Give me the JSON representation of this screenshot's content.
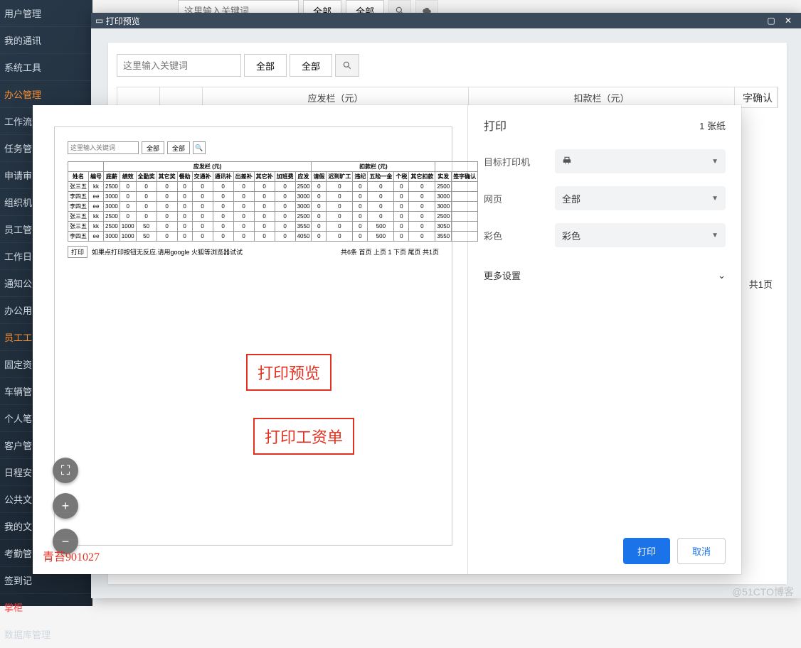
{
  "sidebar": {
    "items": [
      {
        "label": "用户管理"
      },
      {
        "label": "我的通讯"
      },
      {
        "label": "系统工具"
      },
      {
        "label": "办公管理",
        "active": true
      },
      {
        "label": "工作流"
      },
      {
        "label": "任务管"
      },
      {
        "label": "申请审"
      },
      {
        "label": "组织机"
      },
      {
        "label": "员工管"
      },
      {
        "label": "工作日"
      },
      {
        "label": "通知公"
      },
      {
        "label": "办公用"
      },
      {
        "label": "员工工",
        "active": true
      },
      {
        "label": "固定资"
      },
      {
        "label": "车辆管"
      },
      {
        "label": "个人笔"
      },
      {
        "label": "客户管"
      },
      {
        "label": "日程安"
      },
      {
        "label": "公共文"
      },
      {
        "label": "我的文"
      },
      {
        "label": "考勤管"
      },
      {
        "label": "签到记"
      },
      {
        "label": "掌柜",
        "danger": true
      },
      {
        "label": "数据库管理"
      }
    ]
  },
  "bg_toolbar": {
    "placeholder": "这里输入关键词",
    "sel1": "全部",
    "sel2": "全部"
  },
  "modal": {
    "title": "打印预览",
    "inner_placeholder": "这里输入关键词",
    "inner_sel1": "全部",
    "inner_sel2": "全部",
    "bg_table_h1": "应发栏（元）",
    "bg_table_h2": "扣款栏（元）",
    "bg_right_label": "字确认",
    "bg_pagecount": "共1页"
  },
  "preview": {
    "placeholder": "这里输入关键词",
    "sel1": "全部",
    "sel2": "全部",
    "group_pay": "应发栏 (元)",
    "group_deduct": "扣款栏 (元)",
    "cols": [
      "姓名",
      "编号",
      "底薪",
      "绩效",
      "全勤奖",
      "其它奖",
      "餐助",
      "交通补",
      "通讯补",
      "出差补",
      "其它补",
      "加班费",
      "应发",
      "请假",
      "迟到旷工",
      "违纪",
      "五险一金",
      "个税",
      "其它扣款",
      "实发",
      "签字确认"
    ],
    "rows": [
      [
        "张三五",
        "kk",
        "2500",
        "0",
        "0",
        "0",
        "0",
        "0",
        "0",
        "0",
        "0",
        "0",
        "2500",
        "0",
        "0",
        "0",
        "0",
        "0",
        "0",
        "2500",
        ""
      ],
      [
        "李四五",
        "ee",
        "3000",
        "0",
        "0",
        "0",
        "0",
        "0",
        "0",
        "0",
        "0",
        "0",
        "3000",
        "0",
        "0",
        "0",
        "0",
        "0",
        "0",
        "3000",
        ""
      ],
      [
        "李四五",
        "ee",
        "3000",
        "0",
        "0",
        "0",
        "0",
        "0",
        "0",
        "0",
        "0",
        "0",
        "3000",
        "0",
        "0",
        "0",
        "0",
        "0",
        "0",
        "3000",
        ""
      ],
      [
        "张三五",
        "kk",
        "2500",
        "0",
        "0",
        "0",
        "0",
        "0",
        "0",
        "0",
        "0",
        "0",
        "2500",
        "0",
        "0",
        "0",
        "0",
        "0",
        "0",
        "2500",
        ""
      ],
      [
        "张三五",
        "kk",
        "2500",
        "1000",
        "50",
        "0",
        "0",
        "0",
        "0",
        "0",
        "0",
        "0",
        "3550",
        "0",
        "0",
        "0",
        "500",
        "0",
        "0",
        "3050",
        ""
      ],
      [
        "李四五",
        "ee",
        "3000",
        "1000",
        "50",
        "0",
        "0",
        "0",
        "0",
        "0",
        "0",
        "0",
        "4050",
        "0",
        "0",
        "0",
        "500",
        "0",
        "0",
        "3550",
        ""
      ]
    ],
    "print_btn": "打印",
    "print_hint": "如果点打印按钮无反应.请用google 火狐等浏览器试试",
    "pager": "共6条 首页 上页 1 下页 尾页 共1页"
  },
  "anno": {
    "a1": "打印预览",
    "a2": "打印工资单"
  },
  "watermark_left": "青苔901027",
  "settings": {
    "title": "打印",
    "sheets_label": "1 张纸",
    "dest_label": "目标打印机",
    "pages_label": "网页",
    "pages_value": "全部",
    "color_label": "彩色",
    "color_value": "彩色",
    "more": "更多设置",
    "print": "打印",
    "cancel": "取消"
  },
  "global_watermark": "@51CTO博客"
}
